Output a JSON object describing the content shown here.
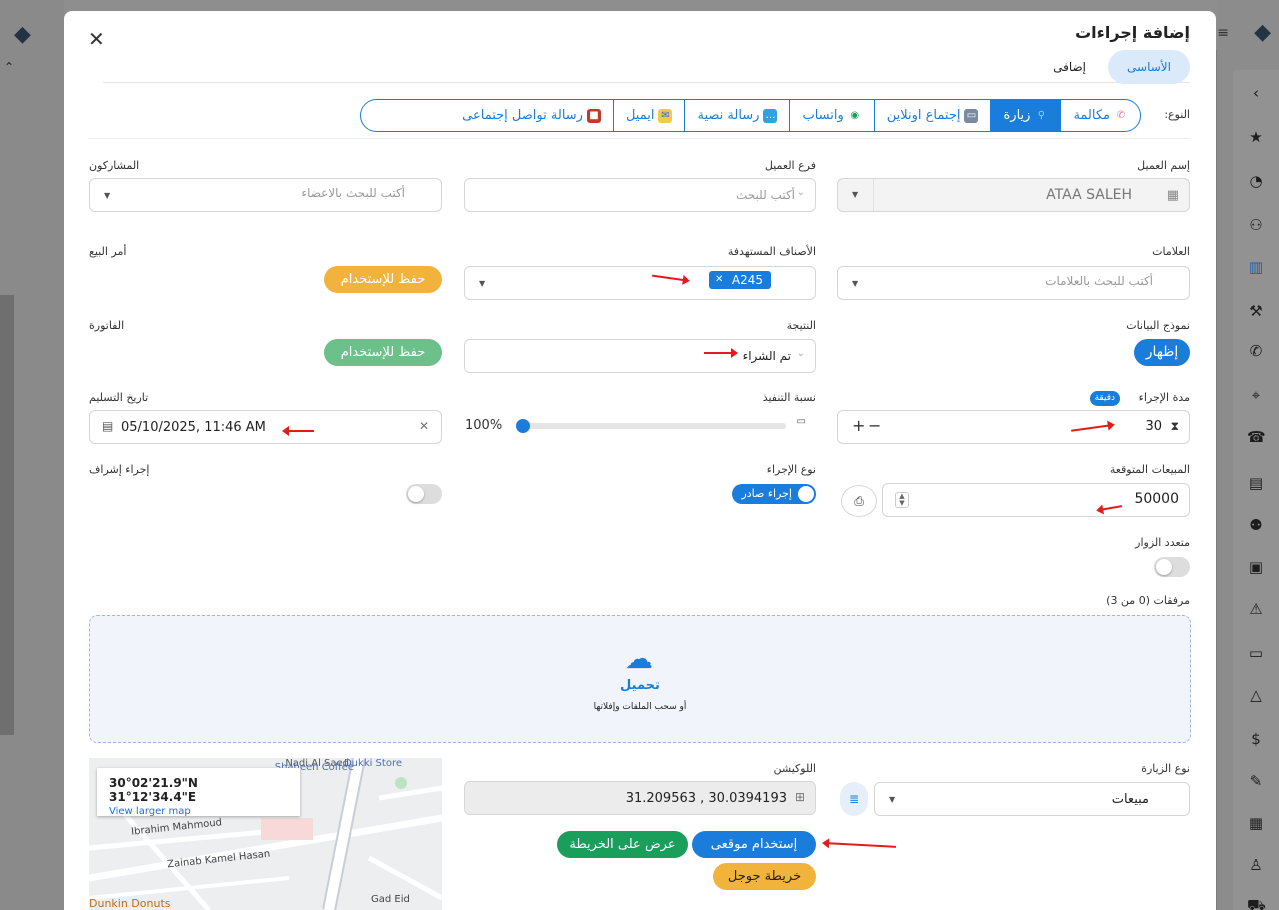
{
  "modal": {
    "title": "إضافة إجراءات",
    "tabs": {
      "basic": "الأساسى",
      "extra": "إضافى"
    }
  },
  "type_selector": {
    "label": "النوع:",
    "options": [
      {
        "label": "مكالمة",
        "icon": "phone-icon"
      },
      {
        "label": "زيارة",
        "icon": "map-pin-icon",
        "selected": true
      },
      {
        "label": "إجتماع اونلاين",
        "icon": "presentation-icon"
      },
      {
        "label": "واتساب",
        "icon": "whatsapp-icon"
      },
      {
        "label": "رسالة نصية",
        "icon": "sms-icon"
      },
      {
        "label": "ايميل",
        "icon": "email-icon"
      },
      {
        "label": "رسالة تواصل إجتماعى",
        "icon": "social-icon"
      }
    ]
  },
  "fields": {
    "customer_name": {
      "label": "إسم العميل",
      "value": "ATAA SALEH"
    },
    "customer_branch": {
      "label": "فرع العميل",
      "placeholder": "أكتب للبحث"
    },
    "participants": {
      "label": "المشاركون",
      "placeholder": "أكتب للبحث بالاعضاء"
    },
    "tags": {
      "label": "العلامات",
      "placeholder": "أكتب للبحث بالعلامات"
    },
    "target_categories": {
      "label": "الأصناف المستهدفة",
      "chip": "A245"
    },
    "sales_order": {
      "label": "أمر البيع",
      "button": "حفظ للإستخدام"
    },
    "data_form": {
      "label": "نموذج البيانات",
      "button": "إظهار"
    },
    "result": {
      "label": "النتيجة",
      "value": "تم الشراء"
    },
    "invoice": {
      "label": "الفاتورة",
      "button": "حفظ للإستخدام"
    },
    "duration": {
      "label": "مدة الإجراء",
      "badge": "دقيقة",
      "value": "30",
      "plus": "+",
      "minus": "−"
    },
    "completion": {
      "label": "نسبة التنفيذ",
      "value": "100%",
      "fraction": 1.0
    },
    "delivery_date": {
      "label": "تاريخ التسليم",
      "value": "05/10/2025, 11:46 AM"
    },
    "expected_sales": {
      "label": "المبيعات المتوقعة",
      "value": "50000"
    },
    "action_type": {
      "label": "نوع الإجراء",
      "value": "إجراء صادر"
    },
    "supervision": {
      "label": "إجراء إشراف"
    },
    "multi_visitors": {
      "label": "متعدد الزوار"
    },
    "attachments": {
      "label": "مرفقات",
      "count": "(0 من 3)",
      "upload": "تحميل",
      "hint": "أو سحب الملفات وإفلاتها"
    },
    "visit_type": {
      "label": "نوع الزيارة",
      "value": "مبيعات"
    },
    "location": {
      "label": "اللوكيشن",
      "value": "31.209563 , 30.0394193"
    }
  },
  "location_buttons": {
    "use_my_location": "إستخدام موقعى",
    "show_on_map": "عرض على الخريطة",
    "google_map": "خريطة جوجل"
  },
  "map": {
    "coords": "30°02'21.9\"N 31°12'34.4\"E",
    "larger": "View larger map",
    "streets": [
      "Nadi Al Saed",
      "Dukki Store",
      "Shaheen Coffee",
      "Ibrahim Mahmoud",
      "Zainab Kamel Hasan",
      "Gad Eid",
      "Dunkin Donuts"
    ]
  },
  "colors": {
    "primary": "#1a7ddb",
    "green": "#1a9e5b",
    "yellow": "#f2b33d",
    "red_arrow": "#e31b1b"
  }
}
